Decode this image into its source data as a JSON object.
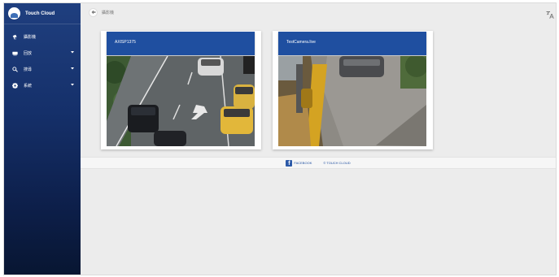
{
  "app": {
    "name": "Touch Cloud"
  },
  "sidebar": {
    "items": [
      {
        "label": "攝影機",
        "icon": "camera-icon",
        "has_submenu": false
      },
      {
        "label": "回放",
        "icon": "video-icon",
        "has_submenu": true
      },
      {
        "label": "搜尋",
        "icon": "search-icon",
        "has_submenu": true
      },
      {
        "label": "系統",
        "icon": "gear-icon",
        "has_submenu": true
      }
    ]
  },
  "topbar": {
    "breadcrumb": "攝影機",
    "back_icon": "arrow-left-icon",
    "translate_icon": "translate-icon"
  },
  "cameras": [
    {
      "name": "AXISP1375"
    },
    {
      "name": "TestCamera.live"
    }
  ],
  "footer": {
    "facebook_label": "FACEBOOK",
    "touch_cloud_label": "© TOUCH CLOUD"
  },
  "colors": {
    "brand": "#1f4fa0",
    "sidebar_top": "#1f3f7f",
    "sidebar_bottom": "#081632",
    "background": "#ececec"
  }
}
